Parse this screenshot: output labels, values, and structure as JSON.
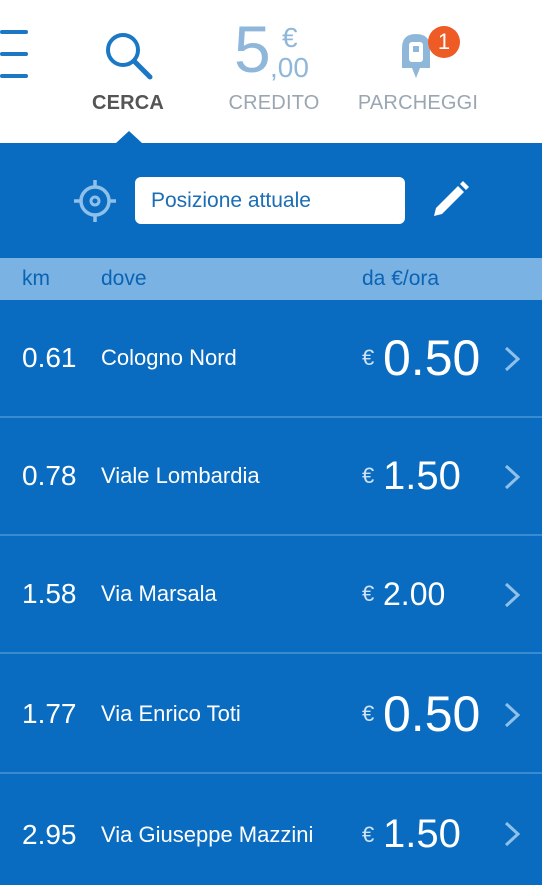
{
  "tabs": {
    "cerca": {
      "label": "CERCA"
    },
    "credito": {
      "label": "CREDITO",
      "amount_int": "5",
      "currency": "€",
      "amount_dec": ",00"
    },
    "parcheggi": {
      "label": "PARCHEGGI",
      "badge": "1"
    }
  },
  "search": {
    "value": "Posizione attuale"
  },
  "columns": {
    "km": "km",
    "where": "dove",
    "price": "da €/ora"
  },
  "rows": [
    {
      "km": "0.61",
      "address": "Cologno Nord",
      "currency": "€",
      "price": "0.50"
    },
    {
      "km": "0.78",
      "address": "Viale Lombardia",
      "currency": "€",
      "price": "1.50"
    },
    {
      "km": "1.58",
      "address": "Via Marsala",
      "currency": "€",
      "price": "2.00"
    },
    {
      "km": "1.77",
      "address": "Via Enrico Toti",
      "currency": "€",
      "price": "0.50"
    },
    {
      "km": "2.95",
      "address": "Via Giuseppe Mazzini",
      "currency": "€",
      "price": "1.50"
    }
  ],
  "colors": {
    "primary": "#0a6cc0",
    "header_row": "#7ab3e3",
    "badge": "#ee5b25",
    "inactive": "#9aa6b2"
  },
  "icons": [
    "menu-icon",
    "search-icon",
    "parking-icon",
    "locate-icon",
    "pencil-icon",
    "chevron-right-icon"
  ]
}
